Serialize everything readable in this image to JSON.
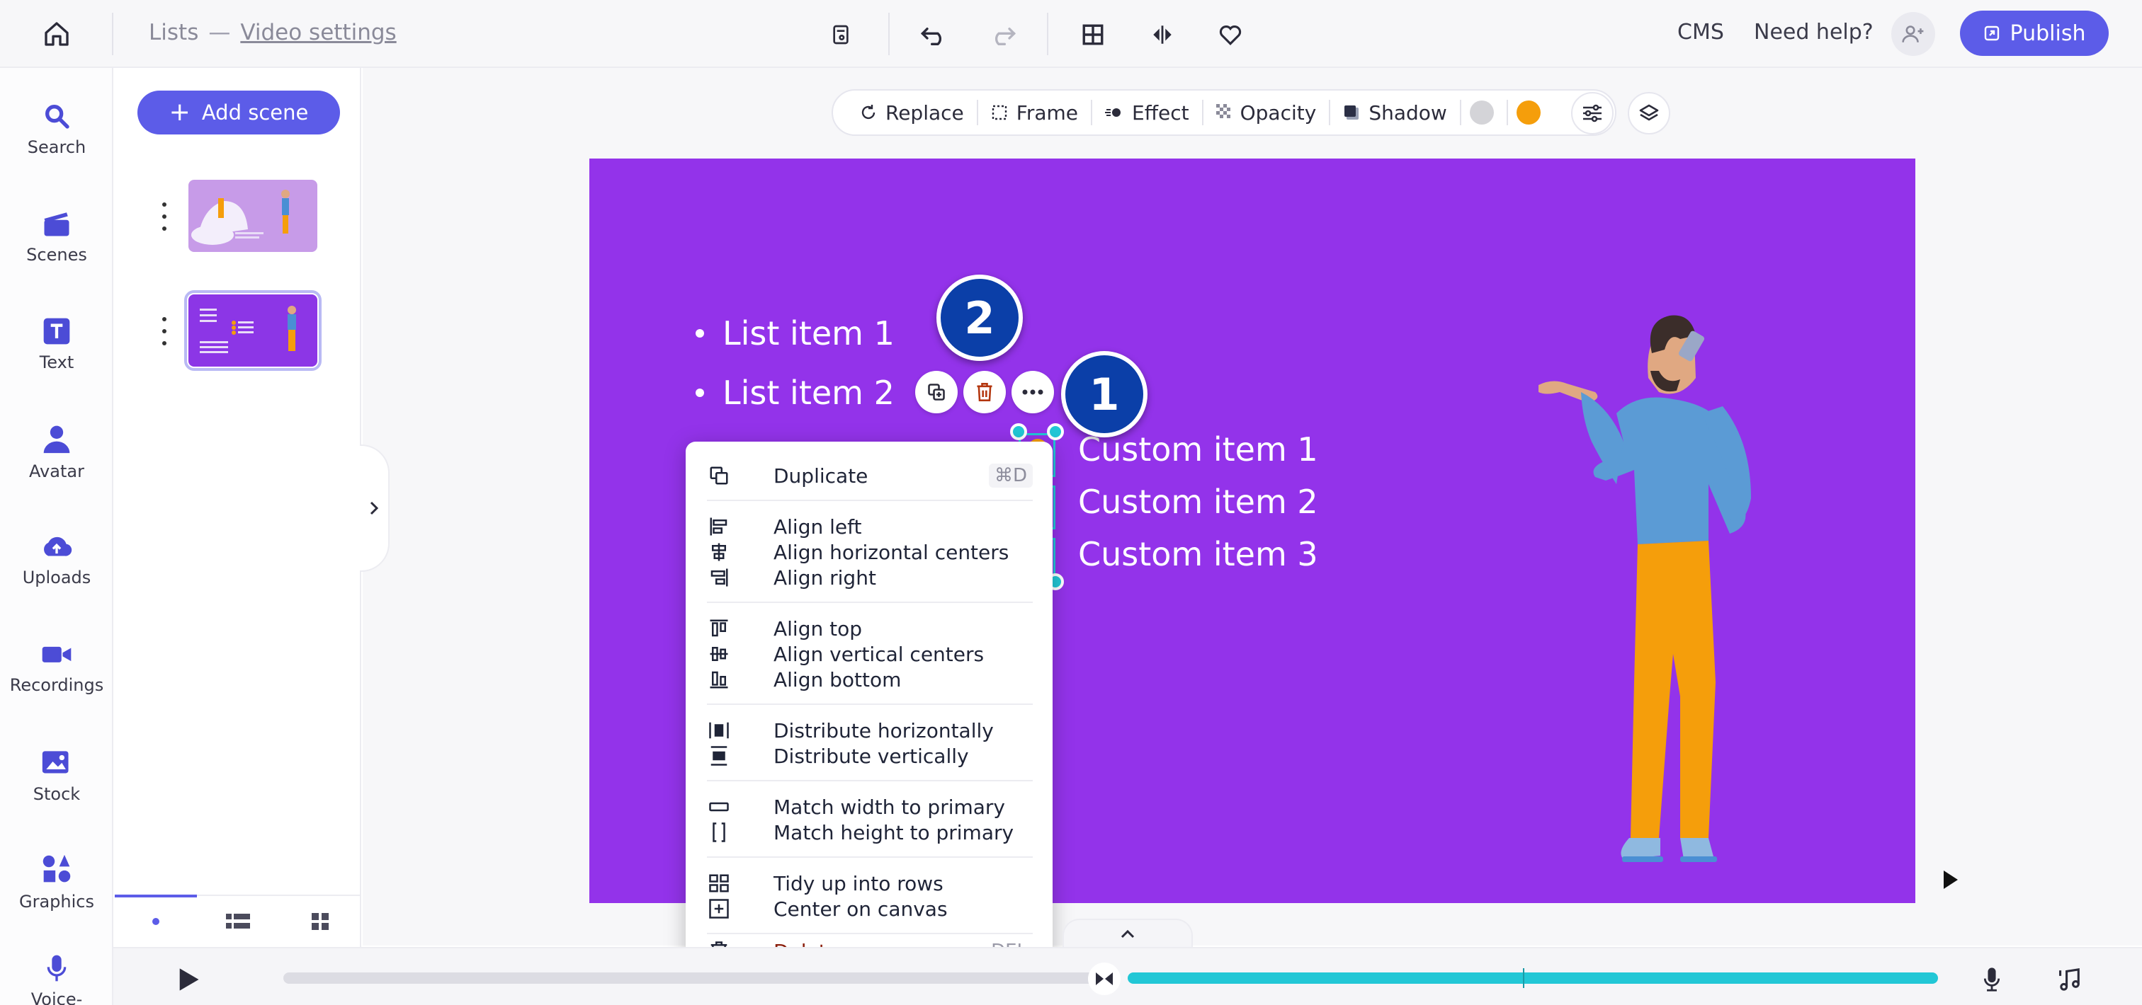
{
  "breadcrumb": {
    "root": "Lists",
    "separator": "—",
    "current": "Video settings"
  },
  "topbar": {
    "cms_label": "CMS",
    "help_label": "Need help?",
    "publish_label": "Publish"
  },
  "leftnav": {
    "items": [
      {
        "label": "Search",
        "icon": "search-icon"
      },
      {
        "label": "Scenes",
        "icon": "scenes-icon"
      },
      {
        "label": "Text",
        "icon": "text-icon"
      },
      {
        "label": "Avatar",
        "icon": "avatar-icon"
      },
      {
        "label": "Uploads",
        "icon": "upload-icon"
      },
      {
        "label": "Recordings",
        "icon": "recording-icon"
      },
      {
        "label": "Stock",
        "icon": "stock-icon"
      },
      {
        "label": "Graphics",
        "icon": "graphics-icon"
      },
      {
        "label": "Voice-",
        "icon": "microphone-icon"
      }
    ]
  },
  "scenes_panel": {
    "add_scene_label": "Add scene"
  },
  "toolbar": {
    "replace": "Replace",
    "frame": "Frame",
    "effect": "Effect",
    "opacity": "Opacity",
    "shadow": "Shadow",
    "swatch_colors": [
      "#d4d4d8",
      "#f59e0b"
    ]
  },
  "canvas": {
    "background": "#9333ea",
    "list_items": [
      "List item 1",
      "List item 2"
    ],
    "custom_items": [
      "Custom item 1",
      "Custom item 2",
      "Custom item 3"
    ]
  },
  "badges": {
    "one": "1",
    "two": "2"
  },
  "context_menu": {
    "duplicate": {
      "label": "Duplicate",
      "shortcut": "⌘D"
    },
    "align_left": "Align left",
    "align_hcenters": "Align horizontal centers",
    "align_right": "Align right",
    "align_top": "Align top",
    "align_vcenters": "Align vertical centers",
    "align_bottom": "Align bottom",
    "distribute_h": "Distribute horizontally",
    "distribute_v": "Distribute vertically",
    "match_width": "Match width to primary",
    "match_height": "Match height to primary",
    "tidy_rows": "Tidy up into rows",
    "center_canvas": "Center on canvas",
    "delete": {
      "label": "Delete",
      "shortcut": "DEL"
    }
  },
  "colors": {
    "accent": "#5c5ce8",
    "selection": "#22c7d6",
    "badge": "#0b3fa8",
    "orange": "#f59e0b"
  }
}
